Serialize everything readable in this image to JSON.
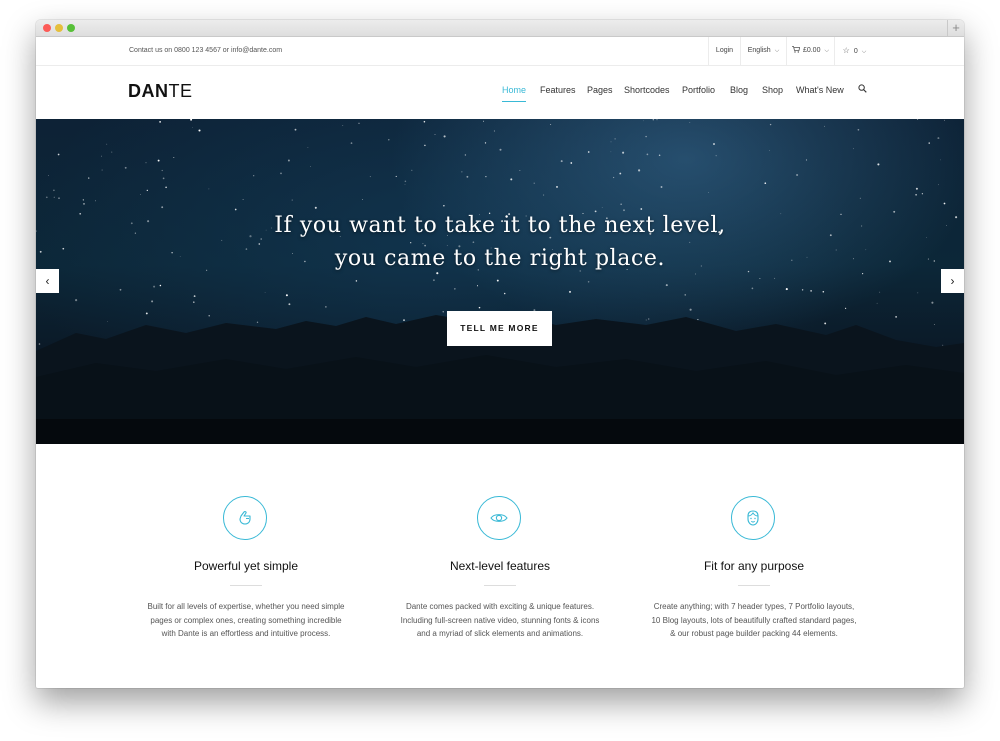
{
  "topbar": {
    "contact": "Contact us on 0800 123 4567 or info@dante.com",
    "login": "Login",
    "language": "English",
    "cart": "£0.00",
    "wishlist_count": "0"
  },
  "header": {
    "logo_bold": "DAN",
    "logo_light": "TE",
    "nav": [
      "Home",
      "Features",
      "Pages",
      "Shortcodes",
      "Portfolio",
      "Blog",
      "Shop",
      "What's New"
    ],
    "active_nav": "Home"
  },
  "hero": {
    "line1": "If you want to take it to the next level,",
    "line2": "you came to the right place.",
    "button": "TELL ME MORE",
    "prev": "‹",
    "next": "›"
  },
  "features": [
    {
      "icon": "hand-icon",
      "title": "Powerful yet simple",
      "lines": [
        "Built for all levels of expertise, whether you need simple",
        "pages or complex ones, creating something incredible",
        "with Dante is an effortless and intuitive process."
      ]
    },
    {
      "icon": "eye-icon",
      "title": "Next-level features",
      "lines": [
        "Dante comes packed with exciting & unique features.",
        "Including full-screen native video, stunning fonts & icons",
        "and a myriad of slick elements and animations."
      ]
    },
    {
      "icon": "face-icon",
      "title": "Fit for any purpose",
      "lines": [
        "Create anything; with 7 header types, 7 Portfolio layouts,",
        "10 Blog layouts, lots of beautifully crafted standard pages,",
        "& our robust page builder packing 44 elements."
      ]
    }
  ],
  "colors": {
    "accent": "#39b9d6",
    "hero_bg": "#0c2738"
  }
}
